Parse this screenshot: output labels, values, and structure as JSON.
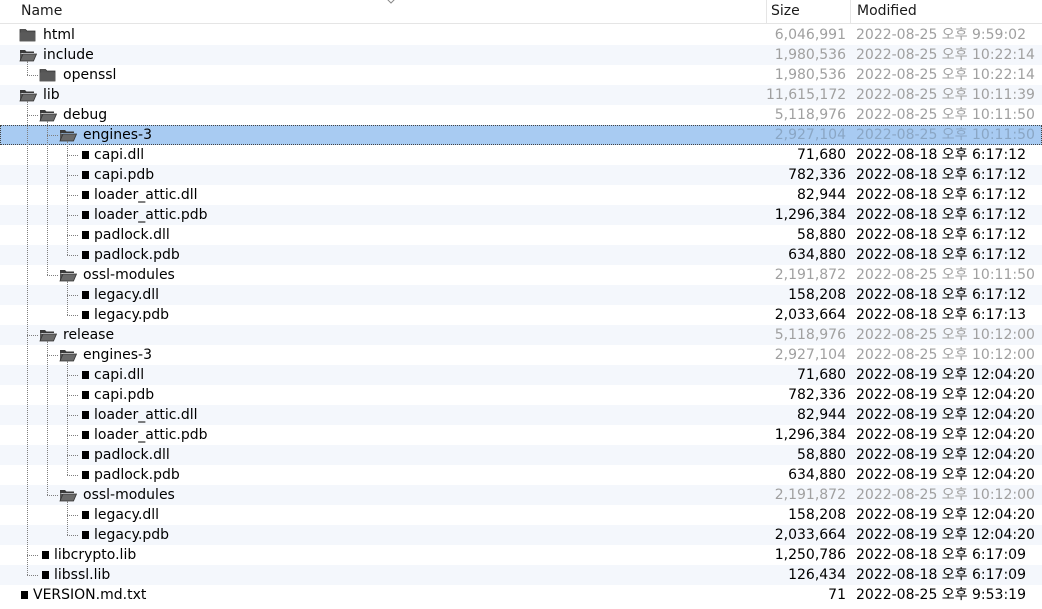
{
  "header": {
    "name": "Name",
    "size": "Size",
    "modified": "Modified"
  },
  "rows": [
    {
      "name": "html",
      "type": "folder",
      "level": 0,
      "size": "6,046,991",
      "modified": "2022-08-25 오후 9:59:02"
    },
    {
      "name": "include",
      "type": "folder-open",
      "level": 0,
      "size": "1,980,536",
      "modified": "2022-08-25 오후 10:22:14"
    },
    {
      "name": "openssl",
      "type": "folder",
      "level": 1,
      "size": "1,980,536",
      "modified": "2022-08-25 오후 10:22:14"
    },
    {
      "name": "lib",
      "type": "folder-open",
      "level": 0,
      "size": "11,615,172",
      "modified": "2022-08-25 오후 10:11:39"
    },
    {
      "name": "debug",
      "type": "folder-open",
      "level": 1,
      "size": "5,118,976",
      "modified": "2022-08-25 오후 10:11:50"
    },
    {
      "name": "engines-3",
      "type": "folder-open",
      "level": 2,
      "size": "2,927,104",
      "modified": "2022-08-25 오후 10:11:50",
      "selected": true
    },
    {
      "name": "capi.dll",
      "type": "file",
      "level": 3,
      "size": "71,680",
      "modified": "2022-08-18 오후 6:17:12"
    },
    {
      "name": "capi.pdb",
      "type": "file",
      "level": 3,
      "size": "782,336",
      "modified": "2022-08-18 오후 6:17:12"
    },
    {
      "name": "loader_attic.dll",
      "type": "file",
      "level": 3,
      "size": "82,944",
      "modified": "2022-08-18 오후 6:17:12"
    },
    {
      "name": "loader_attic.pdb",
      "type": "file",
      "level": 3,
      "size": "1,296,384",
      "modified": "2022-08-18 오후 6:17:12"
    },
    {
      "name": "padlock.dll",
      "type": "file",
      "level": 3,
      "size": "58,880",
      "modified": "2022-08-18 오후 6:17:12"
    },
    {
      "name": "padlock.pdb",
      "type": "file",
      "level": 3,
      "size": "634,880",
      "modified": "2022-08-18 오후 6:17:12"
    },
    {
      "name": "ossl-modules",
      "type": "folder-open",
      "level": 2,
      "size": "2,191,872",
      "modified": "2022-08-25 오후 10:11:50"
    },
    {
      "name": "legacy.dll",
      "type": "file",
      "level": 3,
      "size": "158,208",
      "modified": "2022-08-18 오후 6:17:12"
    },
    {
      "name": "legacy.pdb",
      "type": "file",
      "level": 3,
      "size": "2,033,664",
      "modified": "2022-08-18 오후 6:17:13"
    },
    {
      "name": "release",
      "type": "folder-open",
      "level": 1,
      "size": "5,118,976",
      "modified": "2022-08-25 오후 10:12:00"
    },
    {
      "name": "engines-3",
      "type": "folder-open",
      "level": 2,
      "size": "2,927,104",
      "modified": "2022-08-25 오후 10:12:00"
    },
    {
      "name": "capi.dll",
      "type": "file",
      "level": 3,
      "size": "71,680",
      "modified": "2022-08-19 오후 12:04:20"
    },
    {
      "name": "capi.pdb",
      "type": "file",
      "level": 3,
      "size": "782,336",
      "modified": "2022-08-19 오후 12:04:20"
    },
    {
      "name": "loader_attic.dll",
      "type": "file",
      "level": 3,
      "size": "82,944",
      "modified": "2022-08-19 오후 12:04:20"
    },
    {
      "name": "loader_attic.pdb",
      "type": "file",
      "level": 3,
      "size": "1,296,384",
      "modified": "2022-08-19 오후 12:04:20"
    },
    {
      "name": "padlock.dll",
      "type": "file",
      "level": 3,
      "size": "58,880",
      "modified": "2022-08-19 오후 12:04:20"
    },
    {
      "name": "padlock.pdb",
      "type": "file",
      "level": 3,
      "size": "634,880",
      "modified": "2022-08-19 오후 12:04:20"
    },
    {
      "name": "ossl-modules",
      "type": "folder-open",
      "level": 2,
      "size": "2,191,872",
      "modified": "2022-08-25 오후 10:12:00"
    },
    {
      "name": "legacy.dll",
      "type": "file",
      "level": 3,
      "size": "158,208",
      "modified": "2022-08-19 오후 12:04:20"
    },
    {
      "name": "legacy.pdb",
      "type": "file",
      "level": 3,
      "size": "2,033,664",
      "modified": "2022-08-19 오후 12:04:20"
    },
    {
      "name": "libcrypto.lib",
      "type": "file",
      "level": 1,
      "size": "1,250,786",
      "modified": "2022-08-18 오후 6:17:09"
    },
    {
      "name": "libssl.lib",
      "type": "file",
      "level": 1,
      "size": "126,434",
      "modified": "2022-08-18 오후 6:17:09"
    },
    {
      "name": "VERSION.md.txt",
      "type": "file",
      "level": 0,
      "size": "71",
      "modified": "2022-08-25 오후 9:53:19"
    }
  ],
  "icons": {
    "folder": "folder-icon",
    "folder_open": "folder-open-icon",
    "file": "file-icon",
    "sort": "sort-caret-icon"
  },
  "colors": {
    "selection": "#a8cbf2",
    "alt_row": "#f4f7fc",
    "dim_text": "#a0a0a0"
  }
}
